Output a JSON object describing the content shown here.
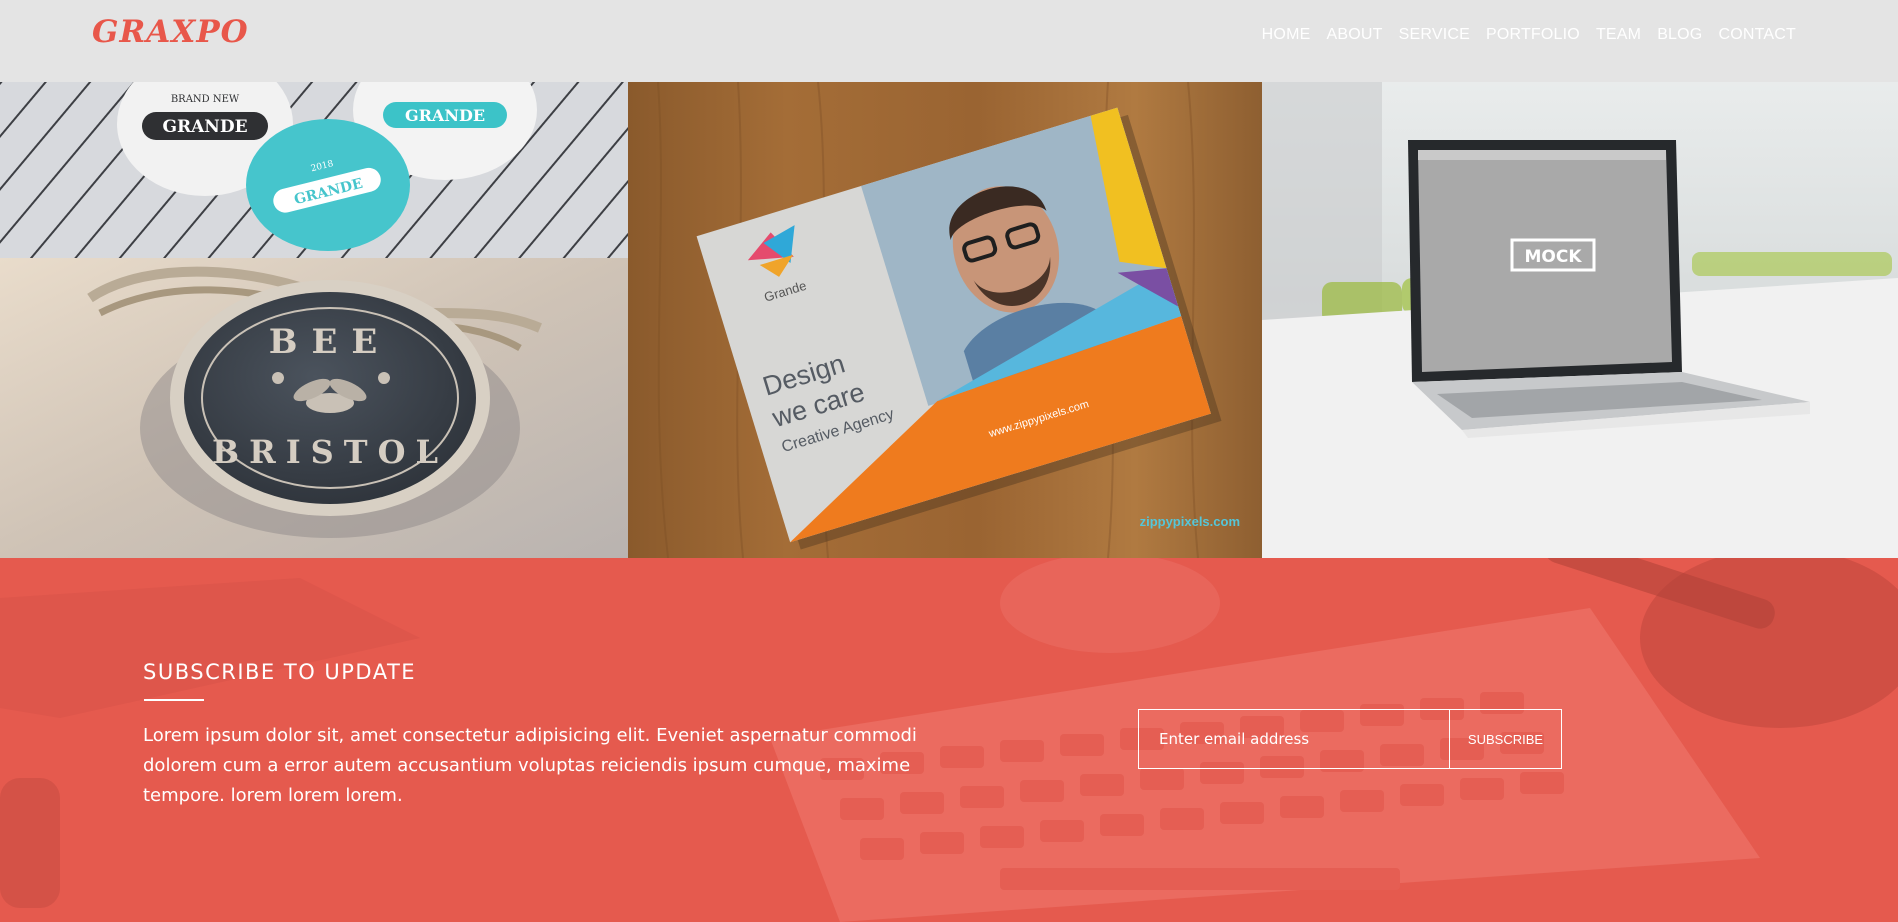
{
  "header": {
    "logo": "GRAXPO",
    "nav": [
      "HOME",
      "ABOUT",
      "SERVICE",
      "PORTFOLIO",
      "TEAM",
      "BLOG",
      "CONTACT"
    ]
  },
  "portfolio": {
    "coasters": {
      "badge_text": "GRANDE",
      "badge_arc": "BRAND NEW",
      "badge_year": "2018"
    },
    "bee_tag": {
      "top_text": "BEE",
      "bottom_text": "BRISTOL"
    },
    "brochure": {
      "brand": "Grande",
      "headline_1": "Design",
      "headline_2": "we care",
      "tagline": "Creative Agency",
      "url": "www.zippypixels.com",
      "watermark": "zippypixels.com"
    },
    "laptop": {
      "screen_text": "MOCK"
    }
  },
  "subscribe": {
    "title": "SUBSCRIBE TO UPDATE",
    "description": "Lorem ipsum dolor sit, amet consectetur adipisicing elit. Eveniet aspernatur commodi dolorem cum a error autem accusantium voluptas reiciendis ipsum cumque, maxime tempore. lorem lorem lorem.",
    "email_placeholder": "Enter email address",
    "button_label": "SUBSCRIBE"
  },
  "colors": {
    "brand": "#e8574a",
    "header_bg": "#e4e4e4",
    "subscribe_bg": "#e75a4f"
  }
}
